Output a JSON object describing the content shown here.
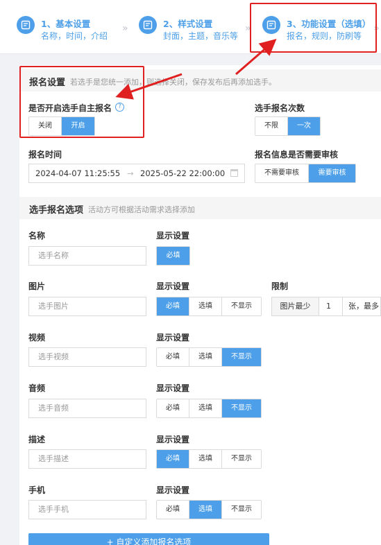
{
  "steps": [
    {
      "title": "1、基本设置",
      "sub": "名称，时间，介绍"
    },
    {
      "title": "2、样式设置",
      "sub": "封面，主题，音乐等"
    },
    {
      "title": "3、功能设置（选填）",
      "sub": "报名，规则，防刷等"
    }
  ],
  "signup_section": {
    "title": "报名设置",
    "note": "若选手是您统一添加，则选择关闭，保存发布后再添加选手。"
  },
  "self_signup": {
    "label": "是否开启选手自主报名",
    "options": [
      "关闭",
      "开启"
    ],
    "selected": "开启"
  },
  "signup_times": {
    "label": "选手报名次数",
    "options": [
      "不限",
      "一次"
    ],
    "selected": "一次"
  },
  "signup_time": {
    "label": "报名时间",
    "start": "2024-04-07 11:25:55",
    "arrow": "→",
    "end": "2025-05-22 22:00:00"
  },
  "review": {
    "label": "报名信息是否需要审核",
    "options": [
      "不需要审核",
      "需要审核"
    ],
    "selected": "需要审核"
  },
  "options_section": {
    "title": "选手报名选项",
    "note": "活动方可根据活动需求选择添加"
  },
  "display_label": "显示设置",
  "fields": [
    {
      "name": "名称",
      "placeholder": "选手名称",
      "options": [
        "必填"
      ],
      "selected": "必填"
    },
    {
      "name": "图片",
      "placeholder": "选手图片",
      "options": [
        "必填",
        "选填",
        "不显示"
      ],
      "selected": "必填"
    },
    {
      "name": "视频",
      "placeholder": "选手视频",
      "options": [
        "必填",
        "选填",
        "不显示"
      ],
      "selected": "不显示"
    },
    {
      "name": "音频",
      "placeholder": "选手音频",
      "options": [
        "必填",
        "选填",
        "不显示"
      ],
      "selected": "不显示"
    },
    {
      "name": "描述",
      "placeholder": "选手描述",
      "options": [
        "必填",
        "选填",
        "不显示"
      ],
      "selected": "必填"
    },
    {
      "name": "手机",
      "placeholder": "选手手机",
      "options": [
        "必填",
        "选填",
        "不显示"
      ],
      "selected": "选填"
    }
  ],
  "limit": {
    "label": "限制",
    "prefix": "图片最少",
    "value": "1",
    "suffix": "张，最多"
  },
  "add_button": "+ 自定义添加报名选项",
  "help_icon": "?",
  "colors": {
    "accent": "#4c9fe8",
    "annotation": "#e02020"
  }
}
